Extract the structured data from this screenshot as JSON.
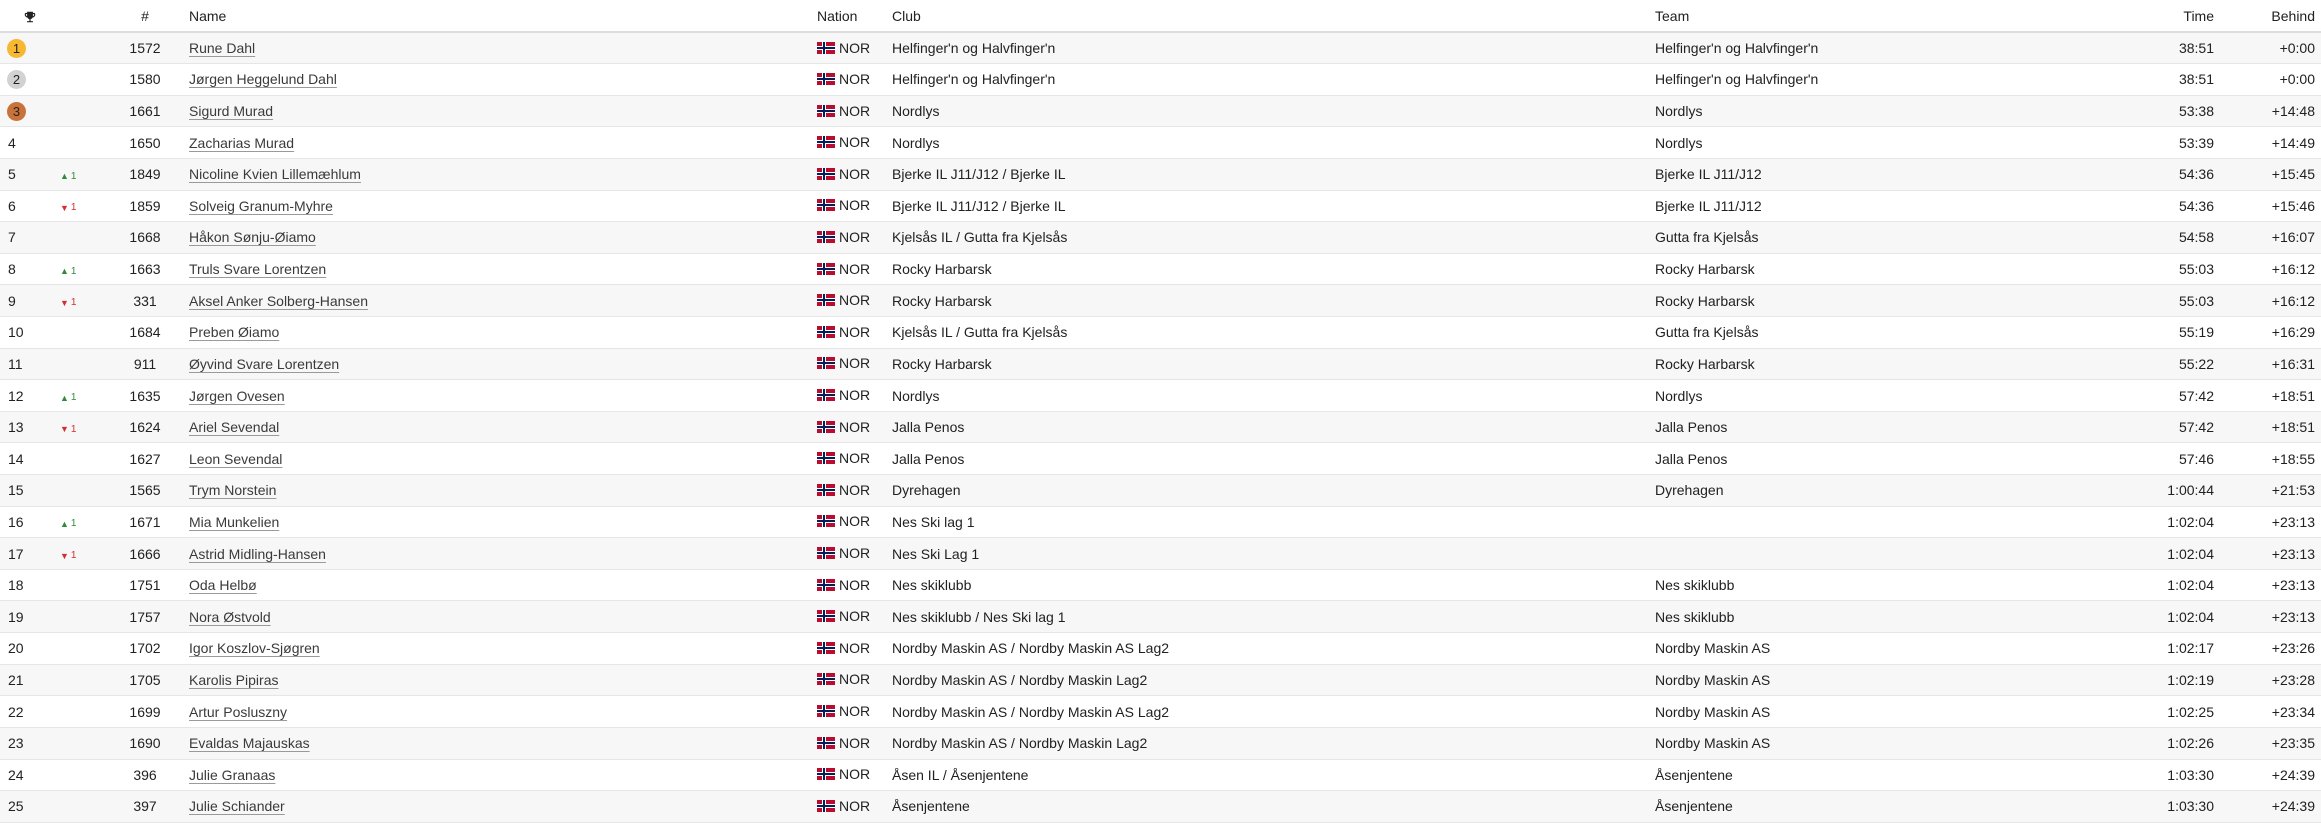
{
  "headers": {
    "rank_icon": "trophy-icon",
    "number": "#",
    "name": "Name",
    "nation": "Nation",
    "club": "Club",
    "team": "Team",
    "time": "Time",
    "behind": "Behind"
  },
  "colors": {
    "gold": "#f7b731",
    "silver": "#d2d2d2",
    "bronze": "#c9733a",
    "up": "#2e8b3a",
    "down": "#d32f2f"
  },
  "rows": [
    {
      "rank": "1",
      "medal": "gold",
      "change": "",
      "change_dir": "",
      "num": "1572",
      "name": "Rune Dahl",
      "nation": "NOR",
      "club": "Helfinger'n og Halvfinger'n",
      "team": "Helfinger'n og Halvfinger'n",
      "time": "38:51",
      "behind": "+0:00"
    },
    {
      "rank": "2",
      "medal": "silver",
      "change": "",
      "change_dir": "",
      "num": "1580",
      "name": "Jørgen Heggelund Dahl",
      "nation": "NOR",
      "club": "Helfinger'n og Halvfinger'n",
      "team": "Helfinger'n og Halvfinger'n",
      "time": "38:51",
      "behind": "+0:00"
    },
    {
      "rank": "3",
      "medal": "bronze",
      "change": "",
      "change_dir": "",
      "num": "1661",
      "name": "Sigurd Murad",
      "nation": "NOR",
      "club": "Nordlys",
      "team": "Nordlys",
      "time": "53:38",
      "behind": "+14:48"
    },
    {
      "rank": "4",
      "medal": "",
      "change": "",
      "change_dir": "",
      "num": "1650",
      "name": "Zacharias Murad",
      "nation": "NOR",
      "club": "Nordlys",
      "team": "Nordlys",
      "time": "53:39",
      "behind": "+14:49"
    },
    {
      "rank": "5",
      "medal": "",
      "change": "1",
      "change_dir": "up",
      "num": "1849",
      "name": "Nicoline Kvien Lillemæhlum",
      "nation": "NOR",
      "club": "Bjerke IL J11/J12 / Bjerke IL",
      "team": "Bjerke IL J11/J12",
      "time": "54:36",
      "behind": "+15:45"
    },
    {
      "rank": "6",
      "medal": "",
      "change": "1",
      "change_dir": "down",
      "num": "1859",
      "name": "Solveig Granum-Myhre",
      "nation": "NOR",
      "club": "Bjerke IL J11/J12 / Bjerke IL",
      "team": "Bjerke IL J11/J12",
      "time": "54:36",
      "behind": "+15:46"
    },
    {
      "rank": "7",
      "medal": "",
      "change": "",
      "change_dir": "",
      "num": "1668",
      "name": "Håkon Sønju-Øiamo",
      "nation": "NOR",
      "club": "Kjelsås IL / Gutta fra Kjelsås",
      "team": "Gutta fra Kjelsås",
      "time": "54:58",
      "behind": "+16:07"
    },
    {
      "rank": "8",
      "medal": "",
      "change": "1",
      "change_dir": "up",
      "num": "1663",
      "name": "Truls Svare Lorentzen",
      "nation": "NOR",
      "club": "Rocky Harbarsk",
      "team": "Rocky Harbarsk",
      "time": "55:03",
      "behind": "+16:12"
    },
    {
      "rank": "9",
      "medal": "",
      "change": "1",
      "change_dir": "down",
      "num": "331",
      "name": "Aksel Anker Solberg-Hansen",
      "nation": "NOR",
      "club": "Rocky Harbarsk",
      "team": "Rocky Harbarsk",
      "time": "55:03",
      "behind": "+16:12"
    },
    {
      "rank": "10",
      "medal": "",
      "change": "",
      "change_dir": "",
      "num": "1684",
      "name": "Preben Øiamo",
      "nation": "NOR",
      "club": "Kjelsås IL / Gutta fra Kjelsås",
      "team": "Gutta fra Kjelsås",
      "time": "55:19",
      "behind": "+16:29"
    },
    {
      "rank": "11",
      "medal": "",
      "change": "",
      "change_dir": "",
      "num": "911",
      "name": "Øyvind Svare Lorentzen",
      "nation": "NOR",
      "club": "Rocky Harbarsk",
      "team": "Rocky Harbarsk",
      "time": "55:22",
      "behind": "+16:31"
    },
    {
      "rank": "12",
      "medal": "",
      "change": "1",
      "change_dir": "up",
      "num": "1635",
      "name": "Jørgen Ovesen",
      "nation": "NOR",
      "club": "Nordlys",
      "team": "Nordlys",
      "time": "57:42",
      "behind": "+18:51"
    },
    {
      "rank": "13",
      "medal": "",
      "change": "1",
      "change_dir": "down",
      "num": "1624",
      "name": "Ariel Sevendal",
      "nation": "NOR",
      "club": "Jalla Penos",
      "team": "Jalla Penos",
      "time": "57:42",
      "behind": "+18:51"
    },
    {
      "rank": "14",
      "medal": "",
      "change": "",
      "change_dir": "",
      "num": "1627",
      "name": "Leon Sevendal",
      "nation": "NOR",
      "club": "Jalla Penos",
      "team": "Jalla Penos",
      "time": "57:46",
      "behind": "+18:55"
    },
    {
      "rank": "15",
      "medal": "",
      "change": "",
      "change_dir": "",
      "num": "1565",
      "name": "Trym Norstein",
      "nation": "NOR",
      "club": "Dyrehagen",
      "team": "Dyrehagen",
      "time": "1:00:44",
      "behind": "+21:53"
    },
    {
      "rank": "16",
      "medal": "",
      "change": "1",
      "change_dir": "up",
      "num": "1671",
      "name": "Mia Munkelien",
      "nation": "NOR",
      "club": "Nes Ski lag 1",
      "team": "",
      "time": "1:02:04",
      "behind": "+23:13"
    },
    {
      "rank": "17",
      "medal": "",
      "change": "1",
      "change_dir": "down",
      "num": "1666",
      "name": "Astrid Midling-Hansen",
      "nation": "NOR",
      "club": "Nes Ski Lag 1",
      "team": "",
      "time": "1:02:04",
      "behind": "+23:13"
    },
    {
      "rank": "18",
      "medal": "",
      "change": "",
      "change_dir": "",
      "num": "1751",
      "name": "Oda Helbø",
      "nation": "NOR",
      "club": "Nes skiklubb",
      "team": "Nes skiklubb",
      "time": "1:02:04",
      "behind": "+23:13"
    },
    {
      "rank": "19",
      "medal": "",
      "change": "",
      "change_dir": "",
      "num": "1757",
      "name": "Nora Østvold",
      "nation": "NOR",
      "club": "Nes skiklubb / Nes Ski lag 1",
      "team": "Nes skiklubb",
      "time": "1:02:04",
      "behind": "+23:13"
    },
    {
      "rank": "20",
      "medal": "",
      "change": "",
      "change_dir": "",
      "num": "1702",
      "name": "Igor Koszlov-Sjøgren",
      "nation": "NOR",
      "club": "Nordby Maskin AS / Nordby Maskin AS Lag2",
      "team": "Nordby Maskin AS",
      "time": "1:02:17",
      "behind": "+23:26"
    },
    {
      "rank": "21",
      "medal": "",
      "change": "",
      "change_dir": "",
      "num": "1705",
      "name": "Karolis Pipiras",
      "nation": "NOR",
      "club": "Nordby Maskin AS / Nordby Maskin Lag2",
      "team": "Nordby Maskin AS",
      "time": "1:02:19",
      "behind": "+23:28"
    },
    {
      "rank": "22",
      "medal": "",
      "change": "",
      "change_dir": "",
      "num": "1699",
      "name": "Artur Posluszny",
      "nation": "NOR",
      "club": "Nordby Maskin AS / Nordby Maskin AS Lag2",
      "team": "Nordby Maskin AS",
      "time": "1:02:25",
      "behind": "+23:34"
    },
    {
      "rank": "23",
      "medal": "",
      "change": "",
      "change_dir": "",
      "num": "1690",
      "name": "Evaldas Majauskas",
      "nation": "NOR",
      "club": "Nordby Maskin AS / Nordby Maskin Lag2",
      "team": "Nordby Maskin AS",
      "time": "1:02:26",
      "behind": "+23:35"
    },
    {
      "rank": "24",
      "medal": "",
      "change": "",
      "change_dir": "",
      "num": "396",
      "name": "Julie Granaas",
      "nation": "NOR",
      "club": "Åsen IL / Åsenjentene",
      "team": "Åsenjentene",
      "time": "1:03:30",
      "behind": "+24:39"
    },
    {
      "rank": "25",
      "medal": "",
      "change": "",
      "change_dir": "",
      "num": "397",
      "name": "Julie Schiander",
      "nation": "NOR",
      "club": "Åsenjentene",
      "team": "Åsenjentene",
      "time": "1:03:30",
      "behind": "+24:39"
    }
  ]
}
